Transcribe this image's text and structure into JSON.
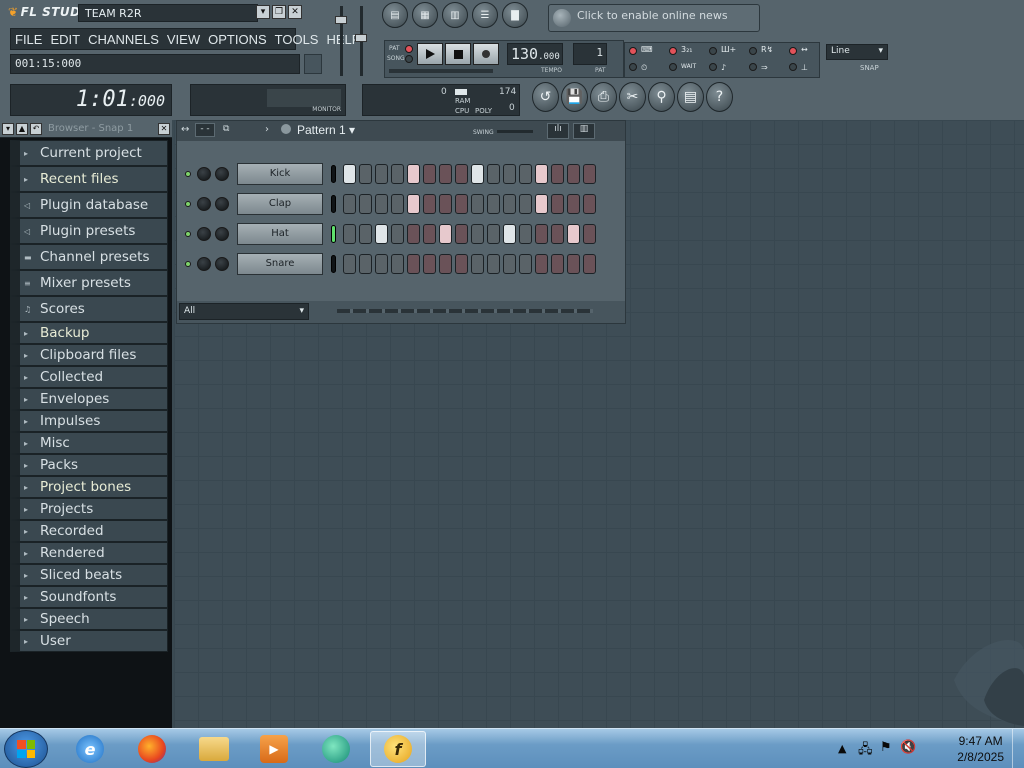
{
  "app": {
    "logo": "FL STUDIO",
    "title_field": "TEAM R2R",
    "window_buttons": [
      "▾",
      "❐",
      "✕"
    ]
  },
  "menu": [
    "FILE",
    "EDIT",
    "CHANNELS",
    "VIEW",
    "OPTIONS",
    "TOOLS",
    "HELP"
  ],
  "hint_bar": "001:15:000",
  "news": {
    "text": "Click to enable online news"
  },
  "transport": {
    "pat_label": "PAT",
    "song_label": "SONG",
    "tempo": "130",
    "tempo_decimal": ".000",
    "tempo_caption": "TEMPO",
    "pattern_number": "1",
    "pattern_caption": "PAT"
  },
  "options": {
    "wait_label": "WAIT",
    "snap_value": "Line",
    "snap_caption": "SNAP"
  },
  "song_time": {
    "main": "1:01",
    "sub": ":000"
  },
  "monitor": {
    "label": "MONITOR"
  },
  "cpu": {
    "ram_label": "RAM",
    "cpu_label": "CPU",
    "poly_label": "POLY",
    "val_top_left": "0",
    "val_top_right": "174",
    "val_bottom": "0"
  },
  "browser": {
    "title": "Browser - Snap 1",
    "items": [
      {
        "label": "Current project",
        "icon": "folder-icon"
      },
      {
        "label": "Recent files",
        "icon": "folder-icon"
      },
      {
        "label": "Plugin database",
        "icon": "speaker-icon"
      },
      {
        "label": "Plugin presets",
        "icon": "speaker-icon"
      },
      {
        "label": "Channel presets",
        "icon": "channel-icon"
      },
      {
        "label": "Mixer presets",
        "icon": "mixer-icon"
      },
      {
        "label": "Scores",
        "icon": "note-icon"
      },
      {
        "label": "Backup",
        "icon": "folder-icon"
      },
      {
        "label": "Clipboard files",
        "icon": "folder-icon"
      },
      {
        "label": "Collected",
        "icon": "folder-icon"
      },
      {
        "label": "Envelopes",
        "icon": "folder-icon"
      },
      {
        "label": "Impulses",
        "icon": "folder-icon"
      },
      {
        "label": "Misc",
        "icon": "folder-icon"
      },
      {
        "label": "Packs",
        "icon": "folder-icon"
      },
      {
        "label": "Project bones",
        "icon": "folder-icon"
      },
      {
        "label": "Projects",
        "icon": "folder-icon"
      },
      {
        "label": "Recorded",
        "icon": "folder-icon"
      },
      {
        "label": "Rendered",
        "icon": "folder-icon"
      },
      {
        "label": "Sliced beats",
        "icon": "folder-icon"
      },
      {
        "label": "Soundfonts",
        "icon": "folder-icon"
      },
      {
        "label": "Speech",
        "icon": "folder-icon"
      },
      {
        "label": "User",
        "icon": "folder-icon"
      }
    ]
  },
  "sequencer": {
    "pattern_title": "Pattern 1",
    "swing_label": "SWING",
    "filter_value": "All",
    "channels": [
      {
        "name": "Kick",
        "selected": false,
        "steps": [
          1,
          0,
          0,
          0,
          2,
          0,
          0,
          0,
          1,
          0,
          0,
          0,
          2,
          0,
          0,
          0
        ]
      },
      {
        "name": "Clap",
        "selected": false,
        "steps": [
          0,
          0,
          0,
          0,
          2,
          0,
          0,
          0,
          0,
          0,
          0,
          0,
          2,
          0,
          0,
          0
        ]
      },
      {
        "name": "Hat",
        "selected": true,
        "steps": [
          0,
          0,
          1,
          0,
          0,
          0,
          2,
          0,
          0,
          0,
          1,
          0,
          0,
          0,
          2,
          0
        ]
      },
      {
        "name": "Snare",
        "selected": false,
        "steps": [
          0,
          0,
          0,
          0,
          0,
          0,
          0,
          0,
          0,
          0,
          0,
          0,
          0,
          0,
          0,
          0
        ]
      }
    ]
  },
  "taskbar": {
    "apps": [
      "internet-explorer-icon",
      "firefox-icon",
      "file-explorer-icon",
      "media-player-icon",
      "messenger-icon",
      "fl-studio-icon"
    ],
    "clock_time": "9:47 AM",
    "clock_date": "2/8/2025"
  },
  "colors": {
    "accent_red": "#e2525a",
    "seq_step_on": "#dfe5e8",
    "seq_step_pink": "#e7c9cd",
    "workspace_bg": "#3e4d56",
    "browser_bg": "#0e1215"
  }
}
